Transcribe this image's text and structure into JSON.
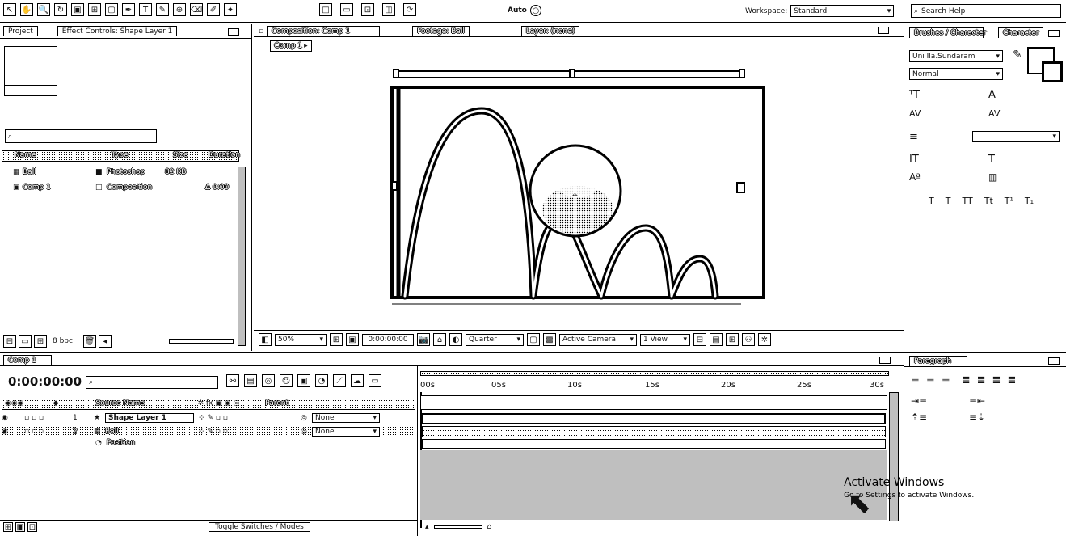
{
  "toolbar": {
    "workspace_label": "Workspace:",
    "workspace_value": "Standard",
    "search_help_placeholder": "Search Help",
    "auto_label": "Auto"
  },
  "project": {
    "tabs": [
      "Project",
      "Effect Controls: Shape Layer 1"
    ],
    "search_placeholder": "",
    "columns": [
      "Name",
      "Type",
      "Size",
      "Duration"
    ],
    "items": [
      {
        "name": "Ball",
        "type": "Photoshop",
        "size": "82 KB",
        "icon": "photoshop-file-icon"
      },
      {
        "name": "Comp 1",
        "type": "Composition",
        "size": "",
        "duration": "Δ 0:00",
        "icon": "composition-icon"
      }
    ],
    "bpc": "8 bpc"
  },
  "composition": {
    "tab": "Composition: Comp 1",
    "other_tabs": [
      "Footage: Ball",
      "Layer: (none)"
    ],
    "breadcrumb": "Comp 1",
    "footer": {
      "zoom": "50%",
      "timecode": "0:00:00:00",
      "resolution": "Quarter",
      "camera": "Active Camera",
      "view": "1 View"
    }
  },
  "info": {
    "tabs": [
      "Brushes / Character",
      "Character"
    ],
    "font_value": "Uni Ila.Sundaram",
    "style_value": "Normal"
  },
  "timeline": {
    "tab": "Comp 1",
    "timecode": "0:00:00:00",
    "search_placeholder": "",
    "column_source": "Source Name",
    "column_parent": "Parent",
    "layers": [
      {
        "num": "1",
        "name": "Shape Layer 1",
        "parent": "None"
      },
      {
        "num": "2",
        "name": "Ball",
        "parent": "None"
      }
    ],
    "property": "Position",
    "property_value": "",
    "ruler_ticks": [
      "00s",
      "05s",
      "10s",
      "15s",
      "20s",
      "25s",
      "30s"
    ],
    "footer_toggle": "Toggle Switches / Modes"
  },
  "paragraph": {
    "tab": "Paragraph"
  },
  "watermark": {
    "title": "Activate Windows",
    "subtitle": "Go to Settings to activate Windows."
  }
}
